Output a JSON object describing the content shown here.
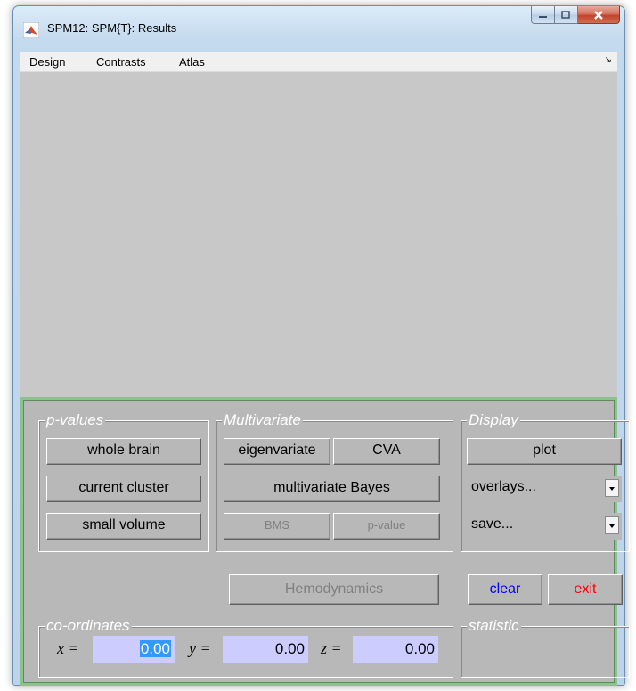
{
  "window": {
    "title": "SPM12: SPM{T}: Results"
  },
  "menu": {
    "items": [
      "Design",
      "Contrasts",
      "Atlas"
    ],
    "corner_glyph": "↘"
  },
  "panel": {
    "pvalues": {
      "title": "p-values",
      "buttons": [
        "whole brain",
        "current cluster",
        "small volume"
      ]
    },
    "multivariate": {
      "title": "Multivariate",
      "eigenvariate": "eigenvariate",
      "cva": "CVA",
      "bayes": "multivariate Bayes",
      "bms": "BMS",
      "pvalue": "p-value"
    },
    "display": {
      "title": "Display",
      "plot": "plot",
      "overlays": "overlays...",
      "save": "save..."
    },
    "hemodynamics": "Hemodynamics",
    "clear": "clear",
    "exit": "exit",
    "coordinates": {
      "title": "co-ordinates",
      "x_label": "x =",
      "x_value": "0.00",
      "y_label": "y =",
      "y_value": "0.00",
      "z_label": "z =",
      "z_value": "0.00"
    },
    "statistic": {
      "title": "statistic",
      "value": ""
    }
  },
  "colors": {
    "panel_green": "#8dc28d",
    "panel_grey": "#b8b8b8",
    "coord_field": "#ccccff",
    "clear_text": "#0000ff",
    "exit_text": "#ff0000"
  },
  "icons": {
    "app": "matlab-icon",
    "minimize": "minimize-icon",
    "maximize": "maximize-icon",
    "close": "close-icon"
  }
}
